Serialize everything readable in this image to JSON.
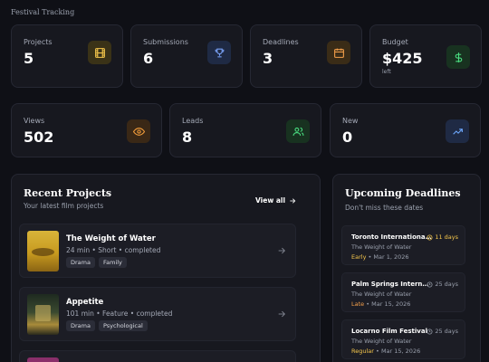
{
  "header": {
    "title": "Festival Tracking"
  },
  "stats_row1": [
    {
      "label": "Projects",
      "value": "5",
      "icon": "film-icon",
      "color": "#f5c64b"
    },
    {
      "label": "Submissions",
      "value": "6",
      "icon": "trophy-icon",
      "color": "#7aa2f7"
    },
    {
      "label": "Deadlines",
      "value": "3",
      "icon": "calendar-icon",
      "color": "#f5a04b"
    },
    {
      "label": "Budget",
      "value": "$425",
      "sub": "left",
      "icon": "dollar-icon",
      "color": "#4ade80"
    }
  ],
  "stats_row2": [
    {
      "label": "Views",
      "value": "502",
      "icon": "eye-icon",
      "color": "#f59e3b"
    },
    {
      "label": "Leads",
      "value": "8",
      "icon": "users-icon",
      "color": "#4ade80"
    },
    {
      "label": "New",
      "value": "0",
      "icon": "trending-up-icon",
      "color": "#6ea8fe"
    }
  ],
  "recent_projects": {
    "title": "Recent Projects",
    "subtitle": "Your latest film projects",
    "view_all": "View all",
    "items": [
      {
        "title": "The Weight of Water",
        "meta": "24 min • Short • completed",
        "tags": [
          "Drama",
          "Family"
        ]
      },
      {
        "title": "Appetite",
        "meta": "101 min • Feature • completed",
        "tags": [
          "Drama",
          "Psychological"
        ]
      }
    ]
  },
  "deadlines": {
    "title": "Upcoming Deadlines",
    "subtitle": "Don't miss these dates",
    "items": [
      {
        "festival": "Toronto International Fi...",
        "film": "The Weight of Water",
        "tier": "Early",
        "date": "Mar 1, 2026",
        "days": "11 days",
        "tier_color": "#f5c64b",
        "days_color": "#f5c64b"
      },
      {
        "festival": "Palm Springs Internati...",
        "film": "The Weight of Water",
        "tier": "Late",
        "date": "Mar 15, 2026",
        "days": "25 days",
        "tier_color": "#f5a04b",
        "days_color": "#9aa0ad"
      },
      {
        "festival": "Locarno Film Festival",
        "film": "The Weight of Water",
        "tier": "Regular",
        "date": "Mar 15, 2026",
        "days": "25 days",
        "tier_color": "#f5c64b",
        "days_color": "#9aa0ad"
      }
    ]
  },
  "separator": "•"
}
